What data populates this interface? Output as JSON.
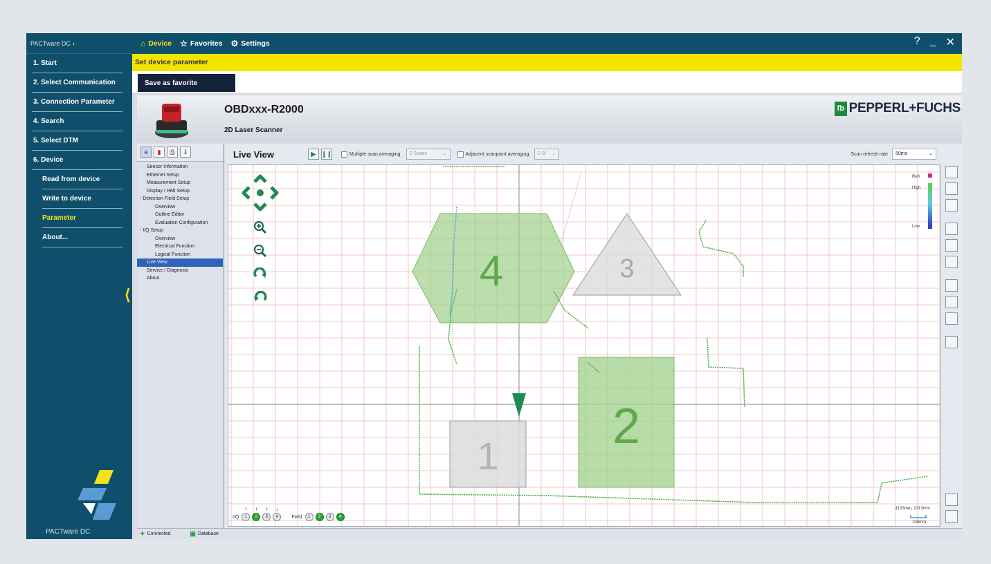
{
  "app": {
    "brand": "PACTware DC",
    "brand_footer": "PACTware DC"
  },
  "leftnav": {
    "items": [
      {
        "label": "1. Start",
        "type": "main"
      },
      {
        "label": "2. Select Communication",
        "type": "main"
      },
      {
        "label": "3. Connection Parameter",
        "type": "main"
      },
      {
        "label": "4. Search",
        "type": "main"
      },
      {
        "label": "5. Select DTM",
        "type": "main"
      },
      {
        "label": "6. Device",
        "type": "main"
      },
      {
        "label": "Read from device",
        "type": "sub"
      },
      {
        "label": "Write to device",
        "type": "sub"
      },
      {
        "label": "Parameter",
        "type": "sub",
        "active": true
      },
      {
        "label": "About...",
        "type": "sub"
      }
    ]
  },
  "topbar": {
    "tabs": [
      {
        "label": "Device",
        "icon": "home-icon"
      },
      {
        "label": "Favorites",
        "icon": "star-icon"
      },
      {
        "label": "Settings",
        "icon": "gear-icon"
      }
    ],
    "help": "?",
    "minimize": "_",
    "close": "✕"
  },
  "banner": {
    "text": "Set device parameter"
  },
  "favbar": {
    "save_label": "Save as favorite"
  },
  "device": {
    "title": "OBDxxx-R2000",
    "subtitle": "2D Laser Scanner",
    "vendor": "PEPPERL+FUCHS",
    "vendor_mark": "fb"
  },
  "tree": {
    "items": [
      {
        "label": "Sensor Information",
        "level": 0
      },
      {
        "label": "Ethernet Setup",
        "level": 0
      },
      {
        "label": "Measurement Setup",
        "level": 0
      },
      {
        "label": "Display / HMI Setup",
        "level": 0
      },
      {
        "label": "Detection Field Setup",
        "level": 0,
        "prefix": "-"
      },
      {
        "label": "Overview",
        "level": 1
      },
      {
        "label": "Outline Editor",
        "level": 1
      },
      {
        "label": "Evaluation Configuration",
        "level": 1
      },
      {
        "label": "I/Q Setup",
        "level": 0,
        "prefix": "-"
      },
      {
        "label": "Overview",
        "level": 1
      },
      {
        "label": "Electrical Function",
        "level": 1
      },
      {
        "label": "Logical Function",
        "level": 1
      },
      {
        "label": "Live View",
        "level": 0,
        "selected": true
      },
      {
        "label": "Service / Diagnosis",
        "level": 0
      },
      {
        "label": "About",
        "level": 0
      }
    ]
  },
  "liveview": {
    "title": "Live View",
    "multi_scan_label": "Multiple scan averaging",
    "multi_scan_value": "2 Scans",
    "adjacent_label": "Adjacent scanpoint averaging",
    "adjacent_value": "2 B",
    "refresh_label": "Scan refresh rate",
    "refresh_value": "50ms",
    "legend": {
      "refl": "Refl.",
      "high": "High",
      "low": "Low"
    },
    "fields": [
      {
        "label": "4",
        "shape": "hexagon",
        "active": true
      },
      {
        "label": "3",
        "shape": "triangle",
        "active": false
      },
      {
        "label": "2",
        "shape": "rectangle",
        "active": true
      },
      {
        "label": "1",
        "shape": "rectangle",
        "active": false
      }
    ],
    "iq_label": "I/Q",
    "iq": [
      {
        "n": "1",
        "on": false,
        "dir": "↑"
      },
      {
        "n": "2",
        "on": true,
        "dir": "↑"
      },
      {
        "n": "3",
        "on": false,
        "dir": "↑"
      },
      {
        "n": "4",
        "on": false,
        "dir": "↓"
      }
    ],
    "field_label": "Field",
    "field_states": [
      {
        "n": "1",
        "on": false
      },
      {
        "n": "2",
        "on": true
      },
      {
        "n": "3",
        "on": false
      },
      {
        "n": "4",
        "on": true
      }
    ],
    "coords": "-1133mm, 2313mm",
    "scale": "100mm"
  },
  "status": {
    "connected": "Connected",
    "database": "Database"
  },
  "colors": {
    "nav": "#0f4f6b",
    "accent": "#f4e21a",
    "field_active": "#9fd08a",
    "field_inactive": "#d3d3d3",
    "scan": "#4daf4a",
    "grid": "#f0b5bc"
  }
}
